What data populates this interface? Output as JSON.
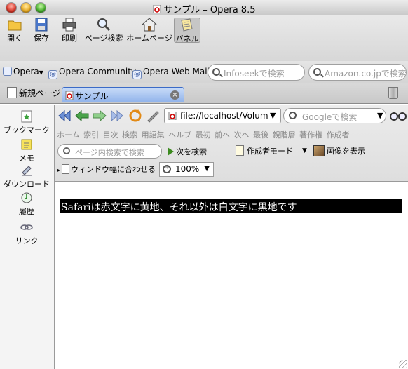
{
  "window": {
    "title": "サンプル – Opera 8.5"
  },
  "toolbar": {
    "open": "開く",
    "save": "保存",
    "print": "印刷",
    "page_search": "ページ検索",
    "home": "ホームページ",
    "panel": "パネル"
  },
  "bookmarks": {
    "opera": "Opera",
    "community": "Opera Community",
    "webmail": "Opera Web Mail",
    "search_infoseek": "Infoseekで検索",
    "search_amazon": "Amazon.co.jpで検索"
  },
  "tabs": {
    "new_page": "新規ページ",
    "active_tab": "サンプル"
  },
  "panel": {
    "bookmarks": "ブックマーク",
    "memo": "メモ",
    "download": "ダウンロード",
    "history": "履歴",
    "links": "リンク"
  },
  "nav": {
    "address": "file://localhost/Volum",
    "google_search": "Googleで検索",
    "links": [
      "ホーム",
      "索引",
      "目次",
      "検索",
      "用語集",
      "ヘルプ",
      "最初",
      "前へ",
      "次へ",
      "最後",
      "親階層",
      "著作権",
      "作成者"
    ],
    "find_placeholder": "ページ内検索で検索",
    "find_next": "次を検索",
    "author_mode": "作成者モード",
    "show_images": "画像を表示",
    "fit_window": "ウィンドウ幅に合わせる",
    "zoom": "100%"
  },
  "content": {
    "text": "Safariは赤文字に黄地、それ以外は白文字に黒地です"
  },
  "colors": {
    "tab_active": "#8fb2ea",
    "highlight_bg": "#000000",
    "highlight_fg": "#ffffff"
  }
}
